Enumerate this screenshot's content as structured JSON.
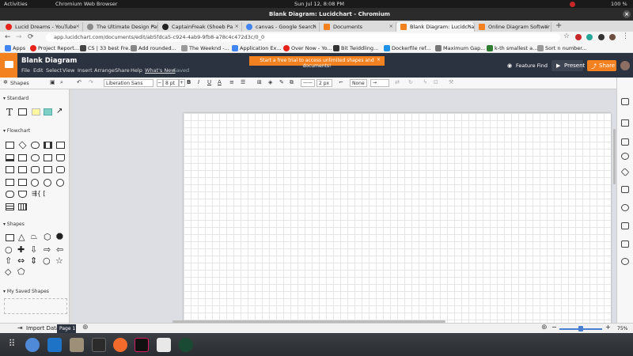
{
  "system": {
    "activities": "Activities",
    "app_menu": "Chromium Web Browser",
    "clock": "Sun Jul 12,  8:08 PM",
    "battery": "100 %"
  },
  "window": {
    "title": "Blank Diagram: Lucidchart - Chromium"
  },
  "tabs": [
    {
      "label": "Lucid Dreams - YouTube",
      "color": "#e62117"
    },
    {
      "label": "The Ultimate Design Patt",
      "color": "#8a8a8a"
    },
    {
      "label": "CaptainFreak (Shoeb Pa",
      "color": "#222"
    },
    {
      "label": "canvas - Google Search",
      "color": "#4285f4"
    },
    {
      "label": "Documents",
      "color": "#f4811f"
    },
    {
      "label": "Blank Diagram: Lucidcha",
      "color": "#f4811f"
    },
    {
      "label": "Online Diagram Softwar",
      "color": "#f4811f"
    }
  ],
  "address": {
    "url": "app.lucidchart.com/documents/edit/ab5fdca5-c924-4ab9-9fb8-a78c4c472d3c/0_0"
  },
  "bookmarks": [
    {
      "label": "Apps",
      "color": "#4285f4"
    },
    {
      "label": "Project Report...",
      "color": "#e62117"
    },
    {
      "label": "CS | 33 best Fre...",
      "color": "#444"
    },
    {
      "label": "Add rounded...",
      "color": "#888"
    },
    {
      "label": "The Weeknd -...",
      "color": "#999"
    },
    {
      "label": "Application Ex...",
      "color": "#4285f4"
    },
    {
      "label": "Over Now - Yo...",
      "color": "#e62117"
    },
    {
      "label": "Bit Twiddling...",
      "color": "#333"
    },
    {
      "label": "Dockerfile ref...",
      "color": "#1d91e6"
    },
    {
      "label": "Maximum Gap...",
      "color": "#777"
    },
    {
      "label": "k-th smallest a...",
      "color": "#2e7d32"
    },
    {
      "label": "Sort n number...",
      "color": "#999"
    }
  ],
  "app": {
    "doc_title": "Blank Diagram",
    "menus": [
      "File",
      "Edit",
      "Select",
      "View",
      "Insert",
      "Arrange",
      "Share",
      "Help",
      "What's New",
      "Saved"
    ],
    "trial_banner": "Start a free trial to access unlimited shapes and documents!",
    "feature_find": "Feature Find",
    "present": "Present",
    "share": "Share",
    "accent": "#f4811f"
  },
  "toolbar": {
    "font": "Liberation Sans",
    "font_size": "8 pt",
    "line_width": "2 px",
    "arrow_start": "None"
  },
  "left_panel": {
    "title": "Shapes",
    "sections": [
      "Standard",
      "Flowchart",
      "Shapes",
      "My Saved Shapes"
    ],
    "import": "Import Data"
  },
  "bottom": {
    "page_tab": "Page 1",
    "zoom": "75%"
  }
}
